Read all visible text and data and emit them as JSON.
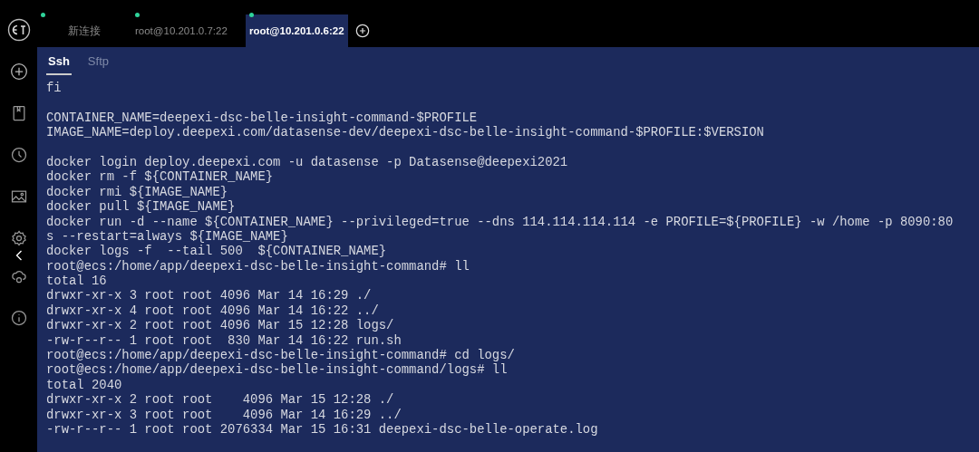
{
  "tabs": [
    {
      "label": "新连接",
      "selected": false,
      "connected": true
    },
    {
      "label": "root@10.201.0.7:22",
      "selected": false,
      "connected": true
    },
    {
      "label": "root@10.201.0.6:22",
      "selected": true,
      "connected": true
    }
  ],
  "sub_tabs": [
    {
      "label": "Ssh",
      "selected": true
    },
    {
      "label": "Sftp",
      "selected": false
    }
  ],
  "terminal": {
    "lines": [
      {
        "kind": "text",
        "text": "fi"
      },
      {
        "kind": "blank"
      },
      {
        "kind": "text",
        "text": "CONTAINER_NAME=deepexi-dsc-belle-insight-command-$PROFILE"
      },
      {
        "kind": "text",
        "text": "IMAGE_NAME=deploy.deepexi.com/datasense-dev/deepexi-dsc-belle-insight-command-$PROFILE:$VERSION"
      },
      {
        "kind": "blank"
      },
      {
        "kind": "text",
        "text": "docker login deploy.deepexi.com -u datasense -p Datasense@deepexi2021"
      },
      {
        "kind": "text",
        "text": "docker rm -f ${CONTAINER_NAME}"
      },
      {
        "kind": "text",
        "text": "docker rmi ${IMAGE_NAME}"
      },
      {
        "kind": "text",
        "text": "docker pull ${IMAGE_NAME}"
      },
      {
        "kind": "text",
        "text": "docker run -d --name ${CONTAINER_NAME} --privileged=true --dns 114.114.114.114 -e PROFILE=${PROFILE} -w /home -p 8090:80"
      },
      {
        "kind": "text",
        "text": "s --restart=always ${IMAGE_NAME}"
      },
      {
        "kind": "text",
        "text": "docker logs -f  --tail 500  ${CONTAINER_NAME}"
      },
      {
        "kind": "text",
        "text": "root@ecs:/home/app/deepexi-dsc-belle-insight-command# ll"
      },
      {
        "kind": "text",
        "text": "total 16"
      },
      {
        "kind": "text",
        "text": "drwxr-xr-x 3 root root 4096 Mar 14 16:29 ./"
      },
      {
        "kind": "text",
        "text": "drwxr-xr-x 4 root root 4096 Mar 14 16:22 ../"
      },
      {
        "kind": "text",
        "text": "drwxr-xr-x 2 root root 4096 Mar 15 12:28 logs/"
      },
      {
        "kind": "text",
        "text": "-rw-r--r-- 1 root root  830 Mar 14 16:22 run.sh"
      },
      {
        "kind": "text",
        "text": "root@ecs:/home/app/deepexi-dsc-belle-insight-command# cd logs/"
      },
      {
        "kind": "text",
        "text": "root@ecs:/home/app/deepexi-dsc-belle-insight-command/logs# ll"
      },
      {
        "kind": "text",
        "text": "total 2040"
      },
      {
        "kind": "text",
        "text": "drwxr-xr-x 2 root root    4096 Mar 15 12:28 ./"
      },
      {
        "kind": "text",
        "text": "drwxr-xr-x 3 root root    4096 Mar 14 16:29 ../"
      },
      {
        "kind": "text",
        "text": "-rw-r--r-- 1 root root 2076334 Mar 15 16:31 deepexi-dsc-belle-operate.log"
      }
    ]
  }
}
